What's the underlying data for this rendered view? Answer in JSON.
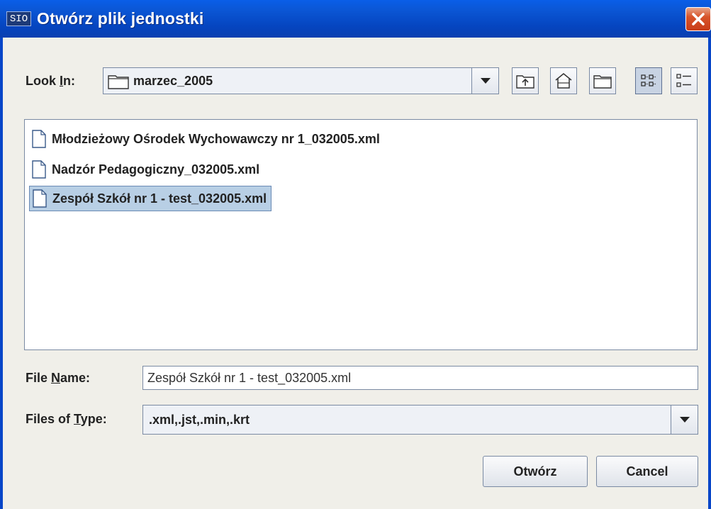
{
  "window": {
    "app_icon_text": "SIO",
    "title": "Otwórz plik jednostki"
  },
  "look_in": {
    "label_pre": "Look ",
    "label_mnemonic": "I",
    "label_post": "n:",
    "value": "marzec_2005"
  },
  "toolbar": {
    "buttons": [
      "up-one-level-icon",
      "home-icon",
      "new-folder-icon",
      "list-view-icon",
      "details-view-icon"
    ],
    "active": "list-view-icon"
  },
  "files": [
    "Młodzieżowy Ośrodek Wychowawczy nr 1_032005.xml",
    "Nadzór Pedagogiczny_032005.xml",
    "Zespół Szkół nr 1 - test_032005.xml"
  ],
  "selected_index": 2,
  "file_name": {
    "label_pre": "File ",
    "label_mnemonic": "N",
    "label_post": "ame:",
    "value": "Zespół Szkół nr 1 - test_032005.xml"
  },
  "files_of_type": {
    "label_pre": "Files of ",
    "label_mnemonic": "T",
    "label_post": "ype:",
    "value": ".xml,.jst,.min,.krt"
  },
  "buttons": {
    "open": "Otwórz",
    "cancel": "Cancel"
  },
  "colors": {
    "titlebar": "#0545c0",
    "selection": "#b8cfe5",
    "close": "#d8542a"
  }
}
